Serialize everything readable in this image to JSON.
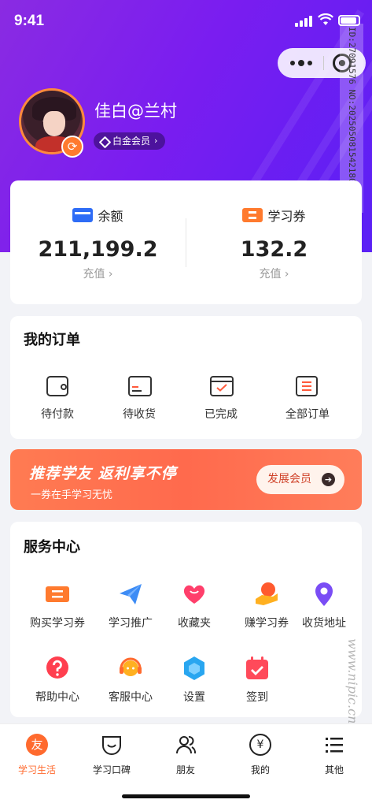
{
  "status_bar": {
    "time": "9:41"
  },
  "watermark": {
    "side_text": "ID:27091576 NO:20250508154218091108",
    "bottom_text": "www.nipic.cn 昵图网"
  },
  "profile": {
    "username": "佳白@兰村",
    "member_badge": "白金会员",
    "chevron": "›"
  },
  "balance": {
    "left": {
      "title": "余额",
      "value": "211,199.2",
      "action": "充值 ›",
      "icon": "wallet-card-icon"
    },
    "right": {
      "title": "学习券",
      "value": "132.2",
      "action": "充值 ›",
      "icon": "ticket-icon"
    }
  },
  "orders": {
    "title": "我的订单",
    "items": [
      {
        "label": "待付款",
        "icon": "wallet-icon"
      },
      {
        "label": "待收货",
        "icon": "delivery-box-icon"
      },
      {
        "label": "已完成",
        "icon": "check-box-icon"
      },
      {
        "label": "全部订单",
        "icon": "list-icon"
      }
    ]
  },
  "promo": {
    "title": "推荐学友  返利享不停",
    "subtitle": "一券在手学习无忧",
    "button": "发展会员",
    "arrow": "➔"
  },
  "services": {
    "title": "服务中心",
    "items": [
      {
        "label": "购买学习券",
        "icon": "ticket-icon"
      },
      {
        "label": "学习推广",
        "icon": "paper-plane-icon"
      },
      {
        "label": "收藏夹",
        "icon": "heart-icon"
      },
      {
        "label": "赚学习券",
        "icon": "earn-ticket-icon"
      },
      {
        "label": "收货地址",
        "icon": "location-pin-icon"
      },
      {
        "label": "帮助中心",
        "icon": "question-icon"
      },
      {
        "label": "客服中心",
        "icon": "headset-icon"
      },
      {
        "label": "设置",
        "icon": "hexagon-settings-icon"
      },
      {
        "label": "签到",
        "icon": "calendar-check-icon"
      }
    ]
  },
  "tabbar": {
    "items": [
      {
        "label": "学习生活",
        "active": true,
        "icon": "friend-circle-icon",
        "glyph": "友"
      },
      {
        "label": "学习口碑",
        "active": false,
        "icon": "smile-icon"
      },
      {
        "label": "朋友",
        "active": false,
        "icon": "friends-icon"
      },
      {
        "label": "我的",
        "active": false,
        "icon": "yen-circle-icon",
        "glyph": "¥"
      },
      {
        "label": "其他",
        "active": false,
        "icon": "menu-list-icon"
      }
    ]
  },
  "colors": {
    "hero_gradient_start": "#8a2be2",
    "hero_gradient_end": "#5a20f5",
    "accent_orange": "#ff6a2e",
    "promo_orange": "#ff7b52",
    "balance_blue": "#2e6cf6"
  }
}
